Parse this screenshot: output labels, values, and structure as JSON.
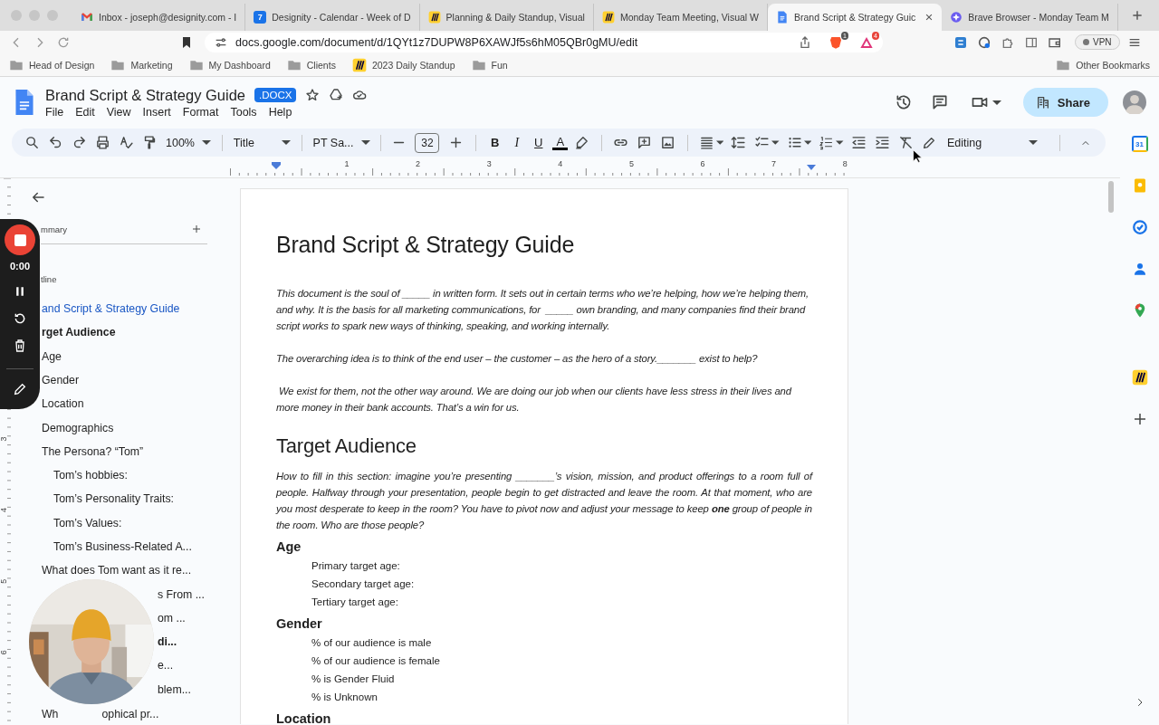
{
  "browser": {
    "tabs": [
      {
        "title": "Inbox - joseph@designity.com - I",
        "kind": "gmail",
        "selected": false
      },
      {
        "title": "Designity - Calendar - Week of D",
        "kind": "calendar",
        "icon_label": "7",
        "selected": false
      },
      {
        "title": "Planning & Daily Standup, Visual",
        "kind": "miro",
        "selected": false
      },
      {
        "title": "Monday Team Meeting, Visual W",
        "kind": "miro",
        "selected": false
      },
      {
        "title": "Brand Script & Strategy Guic",
        "kind": "docs",
        "selected": true
      },
      {
        "title": "Brave Browser - Monday Team M",
        "kind": "brave",
        "selected": false
      }
    ],
    "address": "docs.google.com/document/d/1QYt1z7DUPW8P6XAWJf5s6hM05QBr0gMU/edit",
    "shield_badge": "1",
    "rewards_badge": "4",
    "vpn": "VPN",
    "bookmarks": [
      {
        "label": "Head of Design",
        "kind": "folder"
      },
      {
        "label": "Marketing",
        "kind": "folder"
      },
      {
        "label": "My Dashboard",
        "kind": "folder"
      },
      {
        "label": "Clients",
        "kind": "folder"
      },
      {
        "label": "2023 Daily Standup",
        "kind": "miro"
      },
      {
        "label": "Fun",
        "kind": "folder"
      }
    ],
    "other_bookmarks": "Other Bookmarks"
  },
  "docs": {
    "title": "Brand Script & Strategy Guide",
    "badge": ".DOCX",
    "menus": [
      "File",
      "Edit",
      "View",
      "Insert",
      "Format",
      "Tools",
      "Help"
    ],
    "share": "Share",
    "toolbar": {
      "zoom": "100%",
      "style": "Title",
      "font": "PT Sa...",
      "font_size": "32",
      "text_styles": [
        {
          "label": "B",
          "kind": "bold"
        },
        {
          "label": "I",
          "kind": "italic"
        },
        {
          "label": "U",
          "kind": "underline"
        },
        {
          "label": "A",
          "kind": "color"
        }
      ],
      "mode": "Editing"
    },
    "ruler": [
      "1",
      "2",
      "3",
      "4",
      "5",
      "6",
      "7",
      "8"
    ],
    "vertical_ruler": [
      "3",
      "4",
      "5",
      "6"
    ]
  },
  "side_panel": [
    {
      "kind": "calendar",
      "label": "31"
    },
    {
      "kind": "keep"
    },
    {
      "kind": "tasks"
    },
    {
      "kind": "contacts"
    },
    {
      "kind": "maps"
    },
    {
      "kind": "miro"
    },
    {
      "kind": "add"
    }
  ],
  "outline": {
    "summary_label": "mmary",
    "outline_label": "tline",
    "items": [
      {
        "kind": "full",
        "text": "and Script & Strategy Guide",
        "selected": true,
        "bold": false
      },
      {
        "kind": "full",
        "text": "rget Audience",
        "selected": false,
        "bold": true
      },
      {
        "kind": "full",
        "text": "Age",
        "selected": false,
        "bold": false
      },
      {
        "kind": "full",
        "text": "Gender",
        "selected": false,
        "bold": false
      },
      {
        "kind": "full",
        "text": "Location",
        "selected": false,
        "bold": false
      },
      {
        "kind": "full",
        "text": "Demographics",
        "selected": false,
        "bold": false
      },
      {
        "kind": "full",
        "text": "The Persona? “Tom”",
        "selected": false,
        "bold": false,
        "children": [
          {
            "kind": "full",
            "text": "Tom’s hobbies:",
            "selected": false,
            "bold": false
          },
          {
            "kind": "full",
            "text": "Tom’s Personality Traits:",
            "selected": false,
            "bold": false
          },
          {
            "kind": "full",
            "text": "Tom’s Values:",
            "selected": false,
            "bold": false
          },
          {
            "kind": "full",
            "text": "Tom’s Business-Related A...",
            "selected": false,
            "bold": false
          }
        ]
      },
      {
        "kind": "full",
        "text": "What does Tom want as it re...",
        "selected": false,
        "bold": false
      },
      {
        "kind": "partial",
        "text": "s From ...",
        "selected": false,
        "bold": false
      },
      {
        "kind": "partial",
        "text": "om ...",
        "selected": false,
        "bold": false
      },
      {
        "kind": "partial",
        "text": "di...",
        "selected": false,
        "bold": true
      },
      {
        "kind": "partial",
        "text": "e...",
        "selected": false,
        "bold": false
      },
      {
        "kind": "partial",
        "text": "blem...",
        "selected": false,
        "bold": false
      },
      {
        "kind": "split",
        "text": "Wh",
        "text_right": "ophical pr...",
        "selected": false,
        "bold": false
      }
    ]
  },
  "recorder": {
    "time": "0:00"
  },
  "document": {
    "blocks": [
      {
        "kind": "title",
        "text": "Brand Script & Strategy Guide"
      },
      {
        "kind": "intro",
        "text": "This document is the soul of _____ in written form. It sets out in certain terms who we’re helping, how we’re helping them, and why. It is the basis for all marketing communications, for  _____ own branding, and many companies find their brand script works to spark new ways of thinking, speaking, and working internally."
      },
      {
        "kind": "intro",
        "text": "The overarching idea is to think of the end user – the customer – as the hero of a story._______ exist to help?"
      },
      {
        "kind": "intro",
        "text": " We exist for them, not the other way around. We are doing our job when our clients have less stress in their lives and more money in their bank accounts. That’s a win for us."
      },
      {
        "kind": "heading1",
        "text": "Target Audience"
      },
      {
        "kind": "prompt",
        "text": "How to fill in this section: imagine you’re presenting _______’s vision, mission, and product offerings to a room full of people. Halfway through your presentation, people begin to get distracted and leave the room. At that moment, who are you most desperate to keep in the room? You have to pivot now and adjust your message to keep **one** group of people in the room. Who are those people?"
      },
      {
        "kind": "heading2",
        "text": "Age"
      },
      {
        "kind": "item",
        "text": "Primary target age:"
      },
      {
        "kind": "item",
        "text": "Secondary target age:"
      },
      {
        "kind": "item",
        "text": "Tertiary target age:"
      },
      {
        "kind": "heading2",
        "text": "Gender"
      },
      {
        "kind": "item",
        "text": "% of our audience is male"
      },
      {
        "kind": "item",
        "text": "% of our audience is female"
      },
      {
        "kind": "item",
        "text": "% is Gender Fluid"
      },
      {
        "kind": "item",
        "text": "% is Unknown"
      },
      {
        "kind": "heading2",
        "text": "Location"
      }
    ]
  }
}
